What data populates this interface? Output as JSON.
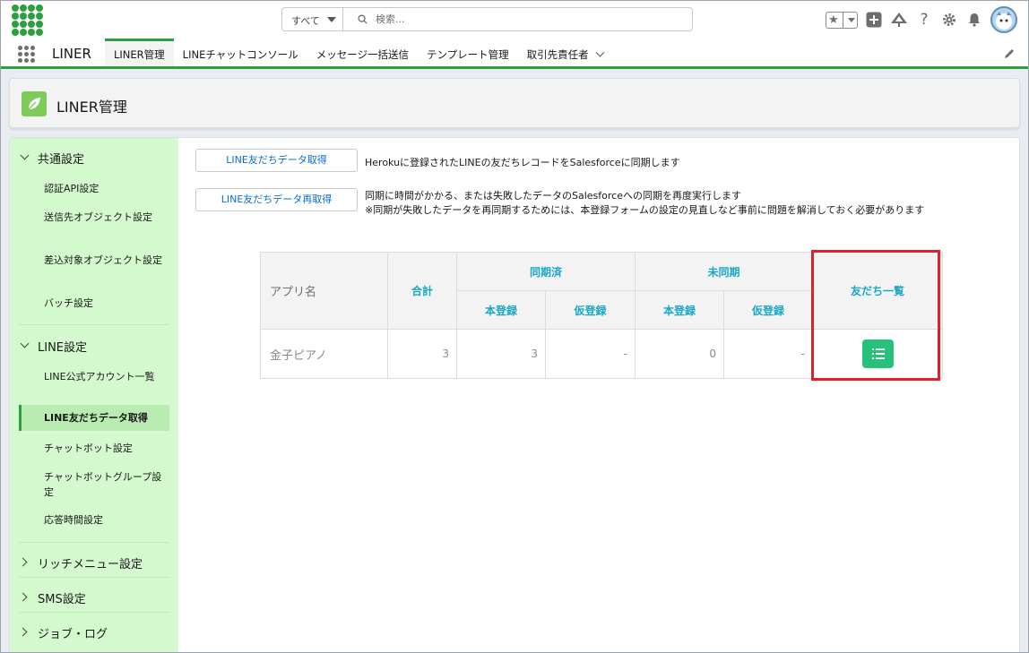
{
  "header": {
    "search_scope": "すべて",
    "search_placeholder": "検索..."
  },
  "nav": {
    "app_name": "LINER",
    "tabs": [
      {
        "label": "LINER管理"
      },
      {
        "label": "LINEチャットコンソール"
      },
      {
        "label": "メッセージ一括送信"
      },
      {
        "label": "テンプレート管理"
      },
      {
        "label": "取引先責任者"
      }
    ]
  },
  "page": {
    "title": "LINER管理"
  },
  "sidebar": {
    "sections": [
      {
        "label": "共通設定",
        "items": [
          "認証API設定",
          "送信先オブジェクト設定",
          "差込対象オブジェクト設定",
          "バッチ設定"
        ]
      },
      {
        "label": "LINE設定",
        "items": [
          "LINE公式アカウント一覧",
          "LINE友だちデータ取得",
          "チャットボット設定",
          "チャットボットグループ設定",
          "応答時間設定"
        ]
      },
      {
        "label": "リッチメニュー設定"
      },
      {
        "label": "SMS設定"
      },
      {
        "label": "ジョブ・ログ"
      }
    ]
  },
  "actions": [
    {
      "button": "LINE友だちデータ取得",
      "description": "Herokuに登録されたLINEの友だちレコードをSalesforceに同期します"
    },
    {
      "button": "LINE友だちデータ再取得",
      "description_line1": "同期に時間がかかる、または失敗したデータのSalesforceへの同期を再度実行します",
      "description_line2": "※同期が失敗したデータを再同期するためには、本登録フォームの設定の見直しなど事前に問題を解消しておく必要があります"
    }
  ],
  "table": {
    "headers": {
      "app_name": "アプリ名",
      "total": "合計",
      "synced": "同期済",
      "unsynced": "未同期",
      "friends_list": "友だち一覧",
      "full_reg": "本登録",
      "temp_reg": "仮登録"
    },
    "rows": [
      {
        "app": "金子ピアノ",
        "total": "3",
        "synced_full": "3",
        "synced_temp": "-",
        "unsynced_full": "0",
        "unsynced_temp": "-"
      }
    ]
  },
  "colors": {
    "brand_green": "#2e9e3e",
    "sidebar_bg": "#d5f9cf",
    "header_text": "#1aa7c7",
    "list_button": "#27c17b",
    "highlight": "#e0202a"
  }
}
